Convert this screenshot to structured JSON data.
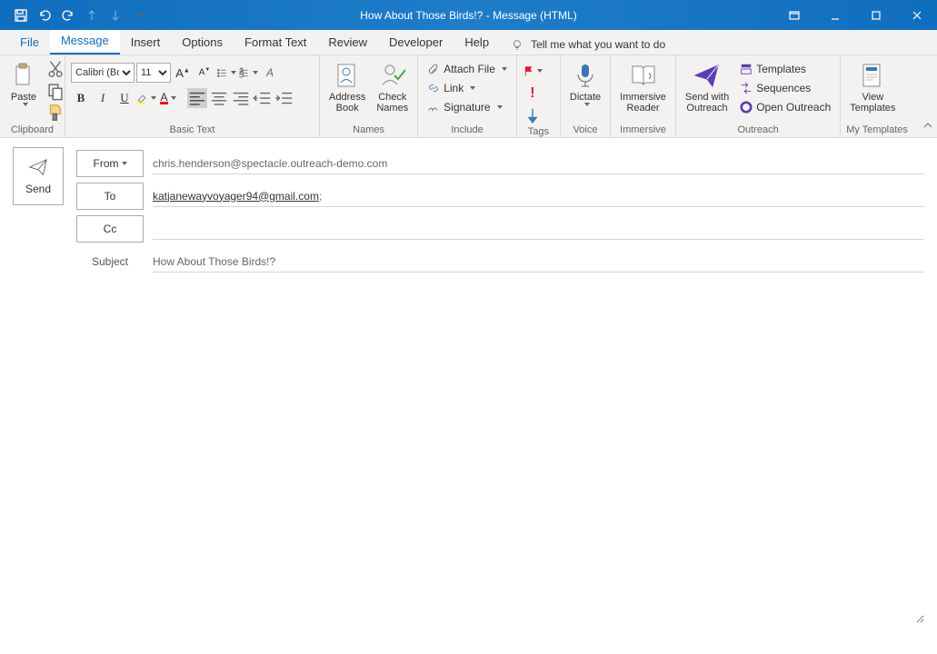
{
  "window": {
    "title": "How About Those Birds!?  -  Message (HTML)"
  },
  "tabs": {
    "file": "File",
    "message": "Message",
    "insert": "Insert",
    "options": "Options",
    "format_text": "Format Text",
    "review": "Review",
    "developer": "Developer",
    "help": "Help",
    "tell_me": "Tell me what you want to do"
  },
  "ribbon": {
    "clipboard": {
      "label": "Clipboard",
      "paste": "Paste"
    },
    "basic_text": {
      "label": "Basic Text",
      "font": "Calibri (Bod",
      "size": "11"
    },
    "names": {
      "label": "Names",
      "address_book": "Address\nBook",
      "check_names": "Check\nNames"
    },
    "include": {
      "label": "Include",
      "attach_file": "Attach File",
      "link": "Link",
      "signature": "Signature"
    },
    "tags": {
      "label": "Tags"
    },
    "voice": {
      "label": "Voice",
      "dictate": "Dictate"
    },
    "immersive": {
      "label": "Immersive",
      "reader": "Immersive\nReader"
    },
    "outreach": {
      "label": "Outreach",
      "send_with": "Send with\nOutreach",
      "templates": "Templates",
      "sequences": "Sequences",
      "open": "Open Outreach"
    },
    "my_templates": {
      "label": "My Templates",
      "view": "View\nTemplates"
    }
  },
  "compose": {
    "send": "Send",
    "from_label": "From",
    "from_value": "chris.henderson@spectacle.outreach-demo.com",
    "to_label": "To",
    "to_value": "katjanewayvoyager94@gmail.com",
    "cc_label": "Cc",
    "cc_value": "",
    "subject_label": "Subject",
    "subject_value": "How About Those Birds!?",
    "body": ""
  }
}
